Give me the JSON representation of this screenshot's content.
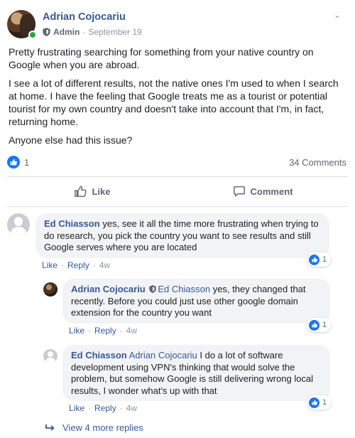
{
  "post": {
    "author": "Adrian Cojocariu",
    "role": "Admin",
    "separator": "·",
    "date": "September 19",
    "paragraphs": [
      "Pretty frustrating searching for something from your native country on Google when you are abroad.",
      "I see a lot of different results, not the native ones I'm used to when I search at home. I have the feeling that Google treats me as a tourist or potential tourist for my own country and doesn't take into account that I'm, in fact, returning home.",
      "Anyone else had this issue?"
    ],
    "reaction_count": "1",
    "comments_count": "34 Comments",
    "like_label": "Like",
    "comment_label": "Comment",
    "caret": "⌄"
  },
  "comments": [
    {
      "author": "Ed Chiasson",
      "text": " yes, see it all the time more frustrating when trying to do research, you pick the country you want to see results and still Google serves where you are located",
      "like": "Like",
      "reply": "Reply",
      "time": "4w",
      "reactions": "1"
    },
    {
      "author": "Adrian Cojocariu",
      "mention": "Ed Chiasson",
      "text": " yes, they changed that recently. Before you could just use other google domain extension for the country you want",
      "like": "Like",
      "reply": "Reply",
      "time": "4w",
      "reactions": "1"
    },
    {
      "author": "Ed Chiasson",
      "mention": "Adrian Cojocariu",
      "text": " I do a lot of software development using VPN's thinking that would solve the problem, but somehow Google is still delivering wrong local results, I wonder what's up with that",
      "like": "Like",
      "reply": "Reply",
      "time": "4w",
      "reactions": "1"
    }
  ],
  "view_more_replies": "View 4 more replies",
  "colors": {
    "link": "#385898",
    "accent": "#1877f2",
    "online": "#31a24c",
    "bubble": "#f2f3f5"
  },
  "icons": [
    "shield-icon",
    "like-icon",
    "comment-icon",
    "reply-arrow-icon",
    "caret-icon"
  ]
}
